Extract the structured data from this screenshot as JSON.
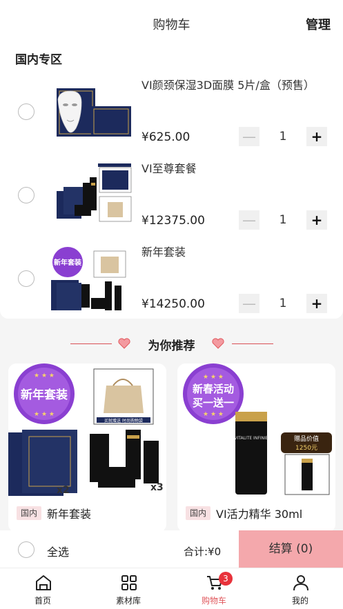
{
  "header": {
    "title": "购物车",
    "manage_label": "管理"
  },
  "cart": {
    "section_title": "国内专区",
    "items": [
      {
        "name": "VI颜颈保湿3D面膜 5片/盒（预售）",
        "price": "¥625.00",
        "quantity": "1"
      },
      {
        "name": "VI至尊套餐",
        "price": "¥12375.00",
        "quantity": "1"
      },
      {
        "name": "新年套装",
        "price": "¥14250.00",
        "quantity": "1"
      }
    ],
    "minus_glyph": "—",
    "plus_glyph": "+"
  },
  "recommend": {
    "title": "为你推荐",
    "products": [
      {
        "tag": "国内",
        "name": "新年套装",
        "badge_text": "新年套装",
        "bag_caption": "买就赠送 时尚购物袋",
        "multiplier_a": "x2",
        "multiplier_b": "x3"
      },
      {
        "tag": "国内",
        "name": "VI活力精华 30ml",
        "badge_text_line1": "新春活动",
        "badge_text_line2": "买一送一",
        "gift_label": "赠品价值",
        "gift_value": "1250元",
        "bottle_brand": "VITALITE INFINIE"
      }
    ]
  },
  "bottom_bar": {
    "select_all_label": "全选",
    "total_label": "合计:¥0",
    "checkout_label": "结算 (0)"
  },
  "tabbar": {
    "tabs": [
      {
        "label": "首页",
        "icon": "home-icon"
      },
      {
        "label": "素材库",
        "icon": "grid-icon"
      },
      {
        "label": "购物车",
        "icon": "cart-icon"
      },
      {
        "label": "我的",
        "icon": "user-icon"
      }
    ],
    "cart_badge": "3"
  },
  "colors": {
    "accent": "#e0585d",
    "checkout_bg": "#f4a8ac",
    "badge": "#e8323b",
    "navy": "#1c2a5c",
    "gold": "#c9a14a",
    "purple": "#8a3fd1"
  }
}
